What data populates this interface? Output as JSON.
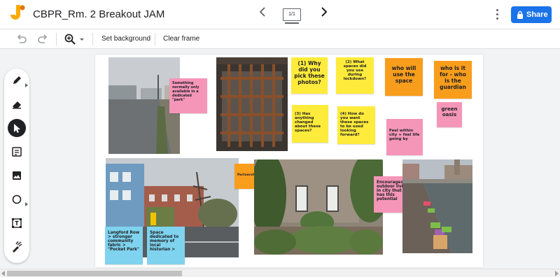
{
  "header": {
    "title": "CBPR_Rm. 2 Breakout JAM",
    "frame_indicator": "1/1",
    "share_label": "Share"
  },
  "toolbar": {
    "set_background": "Set background",
    "clear_frame": "Clear frame"
  },
  "palette": {
    "tools": [
      "pen-icon",
      "eraser-icon",
      "select-icon",
      "sticky-note-icon",
      "image-icon",
      "shape-icon",
      "text-box-icon",
      "laser-icon"
    ],
    "active_tool": "select-icon"
  },
  "notes": {
    "park": "Something normally only available in a dedicated \"park\"",
    "why": "(1) Why did you pick these photos?",
    "spaces": "(2) What spaces did you use during lockdown?",
    "who_use": "who will use the space",
    "who_for": "who is it for - who is the guardian",
    "green": "green oasis",
    "changed": "(3) Has anything changed about these spaces?",
    "howdo": "(4) How do you want these spaces to be used looking forward?",
    "feel": "Feel within city + feel life going by",
    "partnerships": "Partnerships",
    "encourages": "Encourages outdoor living in city that has this potential",
    "langford": "Langford Row > stronger community fabric > \"Pocket Park\"",
    "memory": "Space dedicated to memory of local historian >"
  },
  "colors": {
    "accent": "#1a73e8",
    "yellow_note": "#ffeb3b",
    "pink_note": "#f596b9",
    "orange_note": "#f99d1c",
    "cyan_note": "#7fd3ef"
  }
}
